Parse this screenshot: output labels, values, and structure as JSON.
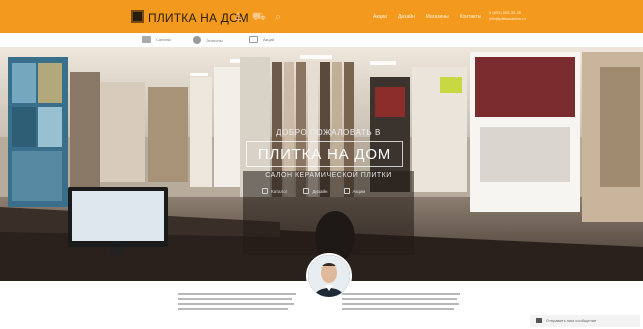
{
  "header": {
    "logo_text": "ПЛИТКА НА ДОМ",
    "nav": [
      "Акции",
      "Дизайн",
      "Магазины",
      "Контакты"
    ],
    "contact_lines": [
      "8 (800) 555-35-35",
      "info@plitkanadom.ru"
    ]
  },
  "subnav": {
    "items": [
      {
        "label": "Салоны"
      },
      {
        "label": "Эталоны"
      },
      {
        "label": "Акции"
      }
    ]
  },
  "hero": {
    "welcome": "ДОБРО ПОЖАЛОВАТЬ В",
    "title": "ПЛИТКА НА ДОМ",
    "subtitle": "САЛОН КЕРАМИЧЕСКОЙ ПЛИТКИ",
    "links": [
      {
        "label": "Каталог"
      },
      {
        "label": "Дизайн"
      },
      {
        "label": "Акции"
      }
    ]
  },
  "notice": {
    "text": "Отправить нам сообщение"
  },
  "colors": {
    "brand_orange": "#f39a1e",
    "logo_dark": "#2a1d0c"
  },
  "icons": [
    "logo-mark-icon",
    "user-icon",
    "cart-icon",
    "search-icon",
    "store-icon",
    "camera-icon",
    "tag-icon",
    "chat-icon"
  ]
}
